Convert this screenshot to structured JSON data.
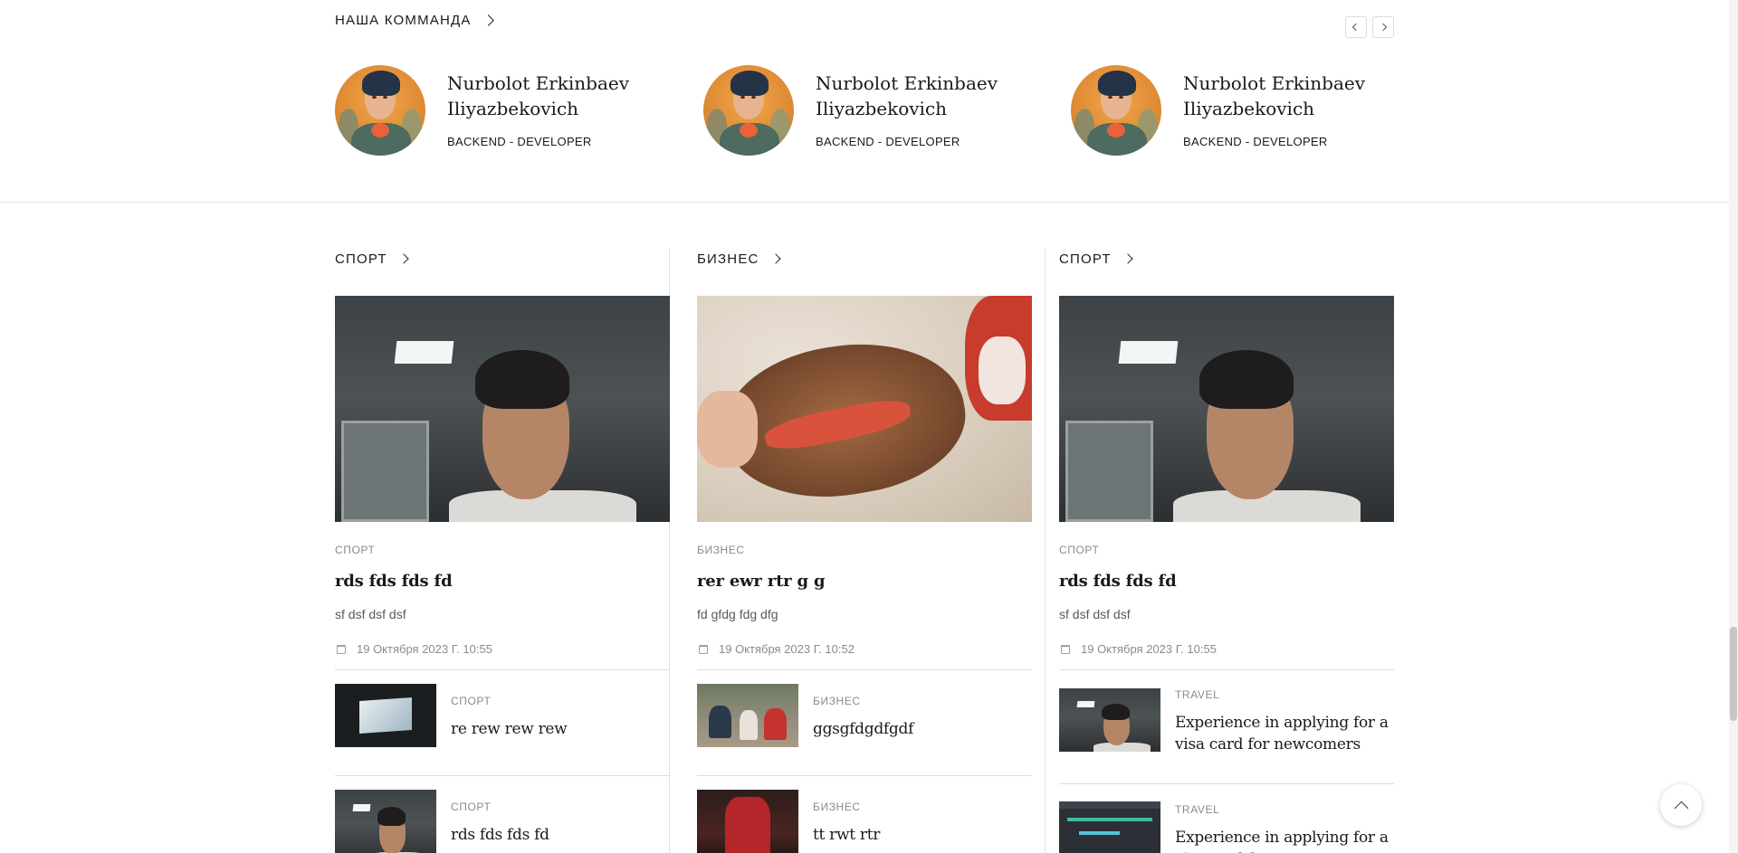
{
  "team": {
    "title": "НАША КОММАНДА",
    "members": [
      {
        "name": "Nurbolot Erkinbaev Iliyazbekovich",
        "role": "BACKEND - DEVELOPER"
      },
      {
        "name": "Nurbolot Erkinbaev Iliyazbekovich",
        "role": "BACKEND - DEVELOPER"
      },
      {
        "name": "Nurbolot Erkinbaev Iliyazbekovich",
        "role": "BACKEND - DEVELOPER"
      }
    ]
  },
  "columns": [
    {
      "category": "СПОРТ",
      "main": {
        "category": "СПОРТ",
        "title": "rds fds fds fd",
        "excerpt": "sf dsf dsf dsf",
        "date": "19 Октября 2023 Г. 10:55"
      },
      "items": [
        {
          "category": "СПОРТ",
          "title": "re rew rew rew"
        },
        {
          "category": "СПОРТ",
          "title": "rds fds fds fd"
        }
      ]
    },
    {
      "category": "БИЗНЕС",
      "main": {
        "category": "БИЗНЕС",
        "title": "rer ewr rtr g g",
        "excerpt": "fd gfdg fdg dfg",
        "date": "19 Октября 2023 Г. 10:52"
      },
      "items": [
        {
          "category": "БИЗНЕС",
          "title": "ggsgfdgdfgdf"
        },
        {
          "category": "БИЗНЕС",
          "title": "tt rwt rtr"
        }
      ]
    },
    {
      "category": "СПОРТ",
      "main": {
        "category": "СПОРТ",
        "title": "rds fds fds fd",
        "excerpt": "sf dsf dsf dsf",
        "date": "19 Октября 2023 Г. 10:55"
      },
      "items": [
        {
          "category": "TRAVEL",
          "title": "Experience in applying for a visa card for newcomers"
        },
        {
          "category": "TRAVEL",
          "title": "Experience in applying for a visa card for newcomers"
        }
      ]
    }
  ],
  "icons": {
    "arrow": "chevron-right-icon",
    "date": "calendar-icon",
    "top": "chevron-up-icon"
  }
}
